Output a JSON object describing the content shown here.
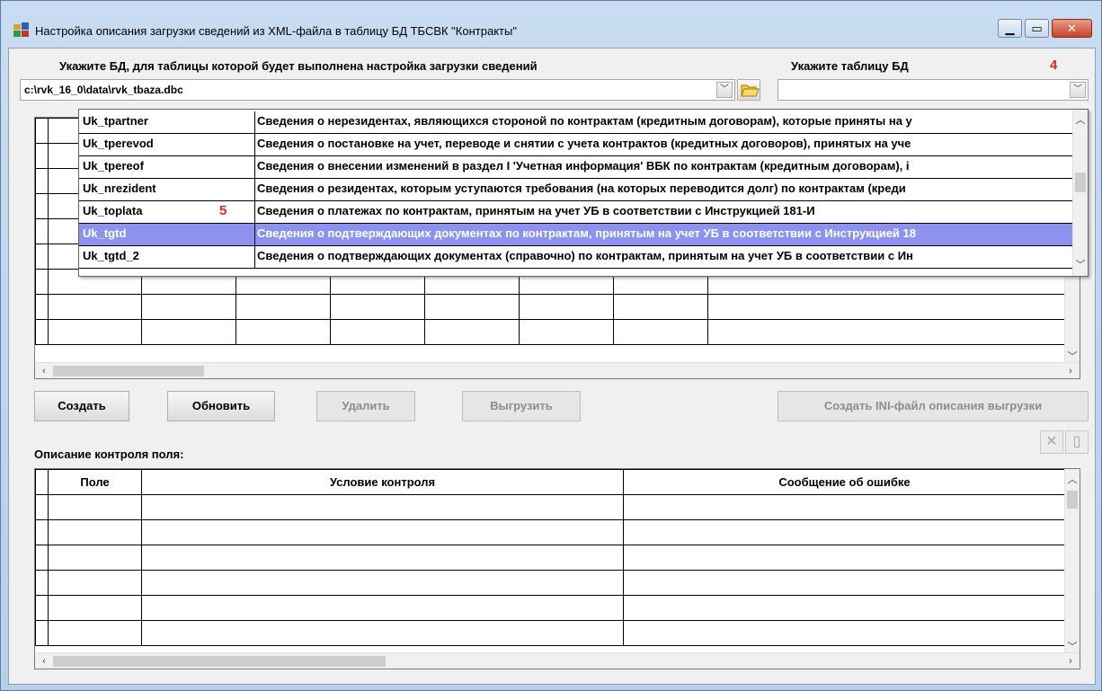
{
  "window": {
    "title": "Настройка описания загрузки сведений из XML-файла в таблицу БД ТБСВК \"Контракты\""
  },
  "db_section": {
    "label": "Укажите БД, для таблицы которой будет выполнена настройка загрузки сведений",
    "path": "c:\\rvk_16_0\\data\\rvk_tbaza.dbc"
  },
  "table_section": {
    "label": "Укажите таблицу БД",
    "marker": "4",
    "value": ""
  },
  "dropdown": {
    "marker": "5",
    "items": [
      {
        "name": "Uk_tpartner",
        "desc": "Сведения о нерезидентах, являющихся стороной по контрактам (кредитным договорам), которые приняты на у"
      },
      {
        "name": "Uk_tperevod",
        "desc": "Сведения о постановке на учет, переводе и снятии с учета контрактов (кредитных договоров), принятых на уче"
      },
      {
        "name": "Uk_tpereof",
        "desc": "Сведения о внесении изменений в раздел I 'Учетная информация' ВБК по контрактам (кредитным договорам), і"
      },
      {
        "name": "Uk_nrezident",
        "desc": "Сведения о резидентах, которым уступаются требования (на которых переводится долг) по контрактам (креди"
      },
      {
        "name": "Uk_toplata",
        "desc": "Сведения о платежах по контрактам, принятым на учет УБ в соответствии с Инструкцией 181-И"
      },
      {
        "name": "Uk_tgtd",
        "desc": "Сведения о подтверждающих документах по контрактам, принятым на учет УБ в соответствии с Инструкцией 18"
      },
      {
        "name": "Uk_tgtd_2",
        "desc": "Сведения о подтверждающих документах (справочно) по контрактам, принятым на учет УБ в соответствии с Ин"
      }
    ],
    "selected_index": 5
  },
  "buttons": {
    "create": "Создать",
    "refresh": "Обновить",
    "delete": "Удалить",
    "export": "Выгрузить",
    "create_ini": "Создать INI-файл описания выгрузки"
  },
  "control_section": {
    "label": "Описание контроля поля:",
    "columns": [
      "Поле",
      "Условие контроля",
      "Сообщение об ошибке"
    ]
  }
}
